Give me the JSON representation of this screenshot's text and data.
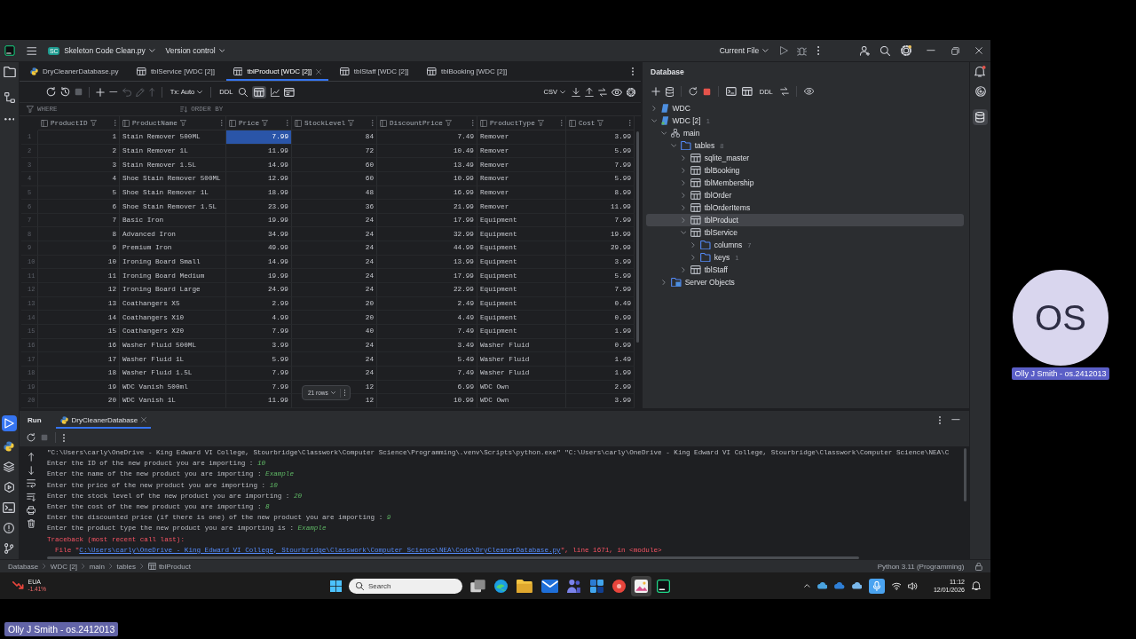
{
  "title_bar": {
    "project_badge": "SC",
    "project": "Skeleton Code Clean.py",
    "vcs": "Version control",
    "run_config": "Current File",
    "settings_badge": true
  },
  "left_tools": {
    "top": [
      {
        "kind": "project",
        "selected": false
      },
      {
        "kind": "structure",
        "selected": false
      },
      {
        "kind": "more",
        "selected": false
      }
    ],
    "bottom": [
      {
        "kind": "run",
        "selected": true
      },
      {
        "kind": "python",
        "selected": false
      },
      {
        "kind": "layers",
        "selected": false
      },
      {
        "kind": "services",
        "selected": false
      },
      {
        "kind": "terminal",
        "selected": false
      },
      {
        "kind": "problems",
        "selected": false
      },
      {
        "kind": "git",
        "selected": false
      }
    ]
  },
  "right_tools": [
    {
      "kind": "notifications",
      "selected": false,
      "badge": true
    },
    {
      "kind": "assistant",
      "selected": false,
      "badge": false
    },
    {
      "kind": "database",
      "selected": true,
      "badge": false
    }
  ],
  "editor_tabs": [
    {
      "label": "DryCleanerDatabase.py",
      "kind": "python",
      "selected": false
    },
    {
      "label": "tblService [WDC [2]]",
      "kind": "table",
      "selected": false
    },
    {
      "label": "tblProduct [WDC [2]]",
      "kind": "table",
      "selected": true
    },
    {
      "label": "tblStaff [WDC [2]]",
      "kind": "table",
      "selected": false
    },
    {
      "label": "tblBooking [WDC [2]]",
      "kind": "table",
      "selected": false
    }
  ],
  "grid_toolbar": {
    "tx_mode": "Tx: Auto",
    "ddl": "DDL",
    "format": "CSV",
    "table_view_selected": true
  },
  "filter_bar": {
    "where": "WHERE",
    "order_by": "ORDER BY"
  },
  "table": {
    "columns": [
      {
        "name": "ProductID",
        "kind": "number"
      },
      {
        "name": "ProductName",
        "kind": "text"
      },
      {
        "name": "Price",
        "kind": "number"
      },
      {
        "name": "StockLevel",
        "kind": "number"
      },
      {
        "name": "DiscountPrice",
        "kind": "number"
      },
      {
        "name": "ProductType",
        "kind": "text"
      },
      {
        "name": "Cost",
        "kind": "number"
      }
    ],
    "rows": [
      {
        "number": "1",
        "cells": [
          {
            "text": "1",
            "selected": false
          },
          {
            "text": "Stain Remover 500ML",
            "selected": false
          },
          {
            "text": "7.99",
            "selected": true
          },
          {
            "text": "84",
            "selected": false
          },
          {
            "text": "7.49",
            "selected": false
          },
          {
            "text": "Remover",
            "selected": false
          },
          {
            "text": "3.99",
            "selected": false
          }
        ]
      },
      {
        "number": "2",
        "cells": [
          {
            "text": "2",
            "selected": false
          },
          {
            "text": "Stain Remover 1L",
            "selected": false
          },
          {
            "text": "11.99",
            "selected": false
          },
          {
            "text": "72",
            "selected": false
          },
          {
            "text": "10.49",
            "selected": false
          },
          {
            "text": "Remover",
            "selected": false
          },
          {
            "text": "5.99",
            "selected": false
          }
        ]
      },
      {
        "number": "3",
        "cells": [
          {
            "text": "3",
            "selected": false
          },
          {
            "text": "Stain Remover 1.5L",
            "selected": false
          },
          {
            "text": "14.99",
            "selected": false
          },
          {
            "text": "60",
            "selected": false
          },
          {
            "text": "13.49",
            "selected": false
          },
          {
            "text": "Remover",
            "selected": false
          },
          {
            "text": "7.99",
            "selected": false
          }
        ]
      },
      {
        "number": "4",
        "cells": [
          {
            "text": "4",
            "selected": false
          },
          {
            "text": "Shoe Stain Remover 500ML",
            "selected": false
          },
          {
            "text": "12.99",
            "selected": false
          },
          {
            "text": "60",
            "selected": false
          },
          {
            "text": "10.99",
            "selected": false
          },
          {
            "text": "Remover",
            "selected": false
          },
          {
            "text": "5.99",
            "selected": false
          }
        ]
      },
      {
        "number": "5",
        "cells": [
          {
            "text": "5",
            "selected": false
          },
          {
            "text": "Shoe Stain Remover 1L",
            "selected": false
          },
          {
            "text": "18.99",
            "selected": false
          },
          {
            "text": "48",
            "selected": false
          },
          {
            "text": "16.99",
            "selected": false
          },
          {
            "text": "Remover",
            "selected": false
          },
          {
            "text": "8.99",
            "selected": false
          }
        ]
      },
      {
        "number": "6",
        "cells": [
          {
            "text": "6",
            "selected": false
          },
          {
            "text": "Shoe Stain Remover 1.5L",
            "selected": false
          },
          {
            "text": "23.99",
            "selected": false
          },
          {
            "text": "36",
            "selected": false
          },
          {
            "text": "21.99",
            "selected": false
          },
          {
            "text": "Remover",
            "selected": false
          },
          {
            "text": "11.99",
            "selected": false
          }
        ]
      },
      {
        "number": "7",
        "cells": [
          {
            "text": "7",
            "selected": false
          },
          {
            "text": "Basic Iron",
            "selected": false
          },
          {
            "text": "19.99",
            "selected": false
          },
          {
            "text": "24",
            "selected": false
          },
          {
            "text": "17.99",
            "selected": false
          },
          {
            "text": "Equipment",
            "selected": false
          },
          {
            "text": "7.99",
            "selected": false
          }
        ]
      },
      {
        "number": "8",
        "cells": [
          {
            "text": "8",
            "selected": false
          },
          {
            "text": "Advanced Iron",
            "selected": false
          },
          {
            "text": "34.99",
            "selected": false
          },
          {
            "text": "24",
            "selected": false
          },
          {
            "text": "32.99",
            "selected": false
          },
          {
            "text": "Equipment",
            "selected": false
          },
          {
            "text": "19.99",
            "selected": false
          }
        ]
      },
      {
        "number": "9",
        "cells": [
          {
            "text": "9",
            "selected": false
          },
          {
            "text": "Premium Iron",
            "selected": false
          },
          {
            "text": "49.99",
            "selected": false
          },
          {
            "text": "24",
            "selected": false
          },
          {
            "text": "44.99",
            "selected": false
          },
          {
            "text": "Equipment",
            "selected": false
          },
          {
            "text": "29.99",
            "selected": false
          }
        ]
      },
      {
        "number": "10",
        "cells": [
          {
            "text": "10",
            "selected": false
          },
          {
            "text": "Ironing Board Small",
            "selected": false
          },
          {
            "text": "14.99",
            "selected": false
          },
          {
            "text": "24",
            "selected": false
          },
          {
            "text": "13.99",
            "selected": false
          },
          {
            "text": "Equipment",
            "selected": false
          },
          {
            "text": "3.99",
            "selected": false
          }
        ]
      },
      {
        "number": "11",
        "cells": [
          {
            "text": "11",
            "selected": false
          },
          {
            "text": "Ironing Board Medium",
            "selected": false
          },
          {
            "text": "19.99",
            "selected": false
          },
          {
            "text": "24",
            "selected": false
          },
          {
            "text": "17.99",
            "selected": false
          },
          {
            "text": "Equipment",
            "selected": false
          },
          {
            "text": "5.99",
            "selected": false
          }
        ]
      },
      {
        "number": "12",
        "cells": [
          {
            "text": "12",
            "selected": false
          },
          {
            "text": "Ironing Board Large",
            "selected": false
          },
          {
            "text": "24.99",
            "selected": false
          },
          {
            "text": "24",
            "selected": false
          },
          {
            "text": "22.99",
            "selected": false
          },
          {
            "text": "Equipment",
            "selected": false
          },
          {
            "text": "7.99",
            "selected": false
          }
        ]
      },
      {
        "number": "13",
        "cells": [
          {
            "text": "13",
            "selected": false
          },
          {
            "text": "Coathangers X5",
            "selected": false
          },
          {
            "text": "2.99",
            "selected": false
          },
          {
            "text": "20",
            "selected": false
          },
          {
            "text": "2.49",
            "selected": false
          },
          {
            "text": "Equipment",
            "selected": false
          },
          {
            "text": "0.49",
            "selected": false
          }
        ]
      },
      {
        "number": "14",
        "cells": [
          {
            "text": "14",
            "selected": false
          },
          {
            "text": "Coathangers X10",
            "selected": false
          },
          {
            "text": "4.99",
            "selected": false
          },
          {
            "text": "20",
            "selected": false
          },
          {
            "text": "4.49",
            "selected": false
          },
          {
            "text": "Equipment",
            "selected": false
          },
          {
            "text": "0.99",
            "selected": false
          }
        ]
      },
      {
        "number": "15",
        "cells": [
          {
            "text": "15",
            "selected": false
          },
          {
            "text": "Coathangers X20",
            "selected": false
          },
          {
            "text": "7.99",
            "selected": false
          },
          {
            "text": "40",
            "selected": false
          },
          {
            "text": "7.49",
            "selected": false
          },
          {
            "text": "Equipment",
            "selected": false
          },
          {
            "text": "1.99",
            "selected": false
          }
        ]
      },
      {
        "number": "16",
        "cells": [
          {
            "text": "16",
            "selected": false
          },
          {
            "text": "Washer Fluid 500ML",
            "selected": false
          },
          {
            "text": "3.99",
            "selected": false
          },
          {
            "text": "24",
            "selected": false
          },
          {
            "text": "3.49",
            "selected": false
          },
          {
            "text": "Washer Fluid",
            "selected": false
          },
          {
            "text": "0.99",
            "selected": false
          }
        ]
      },
      {
        "number": "17",
        "cells": [
          {
            "text": "17",
            "selected": false
          },
          {
            "text": "Washer Fluid 1L",
            "selected": false
          },
          {
            "text": "5.99",
            "selected": false
          },
          {
            "text": "24",
            "selected": false
          },
          {
            "text": "5.49",
            "selected": false
          },
          {
            "text": "Washer Fluid",
            "selected": false
          },
          {
            "text": "1.49",
            "selected": false
          }
        ]
      },
      {
        "number": "18",
        "cells": [
          {
            "text": "18",
            "selected": false
          },
          {
            "text": "Washer Fluid 1.5L",
            "selected": false
          },
          {
            "text": "7.99",
            "selected": false
          },
          {
            "text": "24",
            "selected": false
          },
          {
            "text": "7.49",
            "selected": false
          },
          {
            "text": "Washer Fluid",
            "selected": false
          },
          {
            "text": "1.99",
            "selected": false
          }
        ]
      },
      {
        "number": "19",
        "cells": [
          {
            "text": "19",
            "selected": false
          },
          {
            "text": "WDC Vanish 500ml",
            "selected": false
          },
          {
            "text": "7.99",
            "selected": false
          },
          {
            "text": "12",
            "selected": false
          },
          {
            "text": "6.99",
            "selected": false
          },
          {
            "text": "WDC Own",
            "selected": false
          },
          {
            "text": "2.99",
            "selected": false
          }
        ]
      },
      {
        "number": "20",
        "cells": [
          {
            "text": "20",
            "selected": false
          },
          {
            "text": "WDC Vanish 1L",
            "selected": false
          },
          {
            "text": "11.99",
            "selected": false
          },
          {
            "text": "12",
            "selected": false
          },
          {
            "text": "10.99",
            "selected": false
          },
          {
            "text": "WDC Own",
            "selected": false
          },
          {
            "text": "3.99",
            "selected": false
          }
        ]
      }
    ],
    "row_count": "21 rows"
  },
  "database_panel": {
    "title": "Database",
    "ddl": "DDL",
    "tree": [
      {
        "label": "WDC",
        "kind": "datasource",
        "connected": false,
        "expanded": false,
        "selected": false
      },
      {
        "label": "WDC [2]",
        "kind": "datasource",
        "connected": true,
        "count": "1",
        "expanded": true,
        "selected": false,
        "children": [
          {
            "label": "main",
            "kind": "schema",
            "expanded": true,
            "selected": false,
            "children": [
              {
                "label": "tables",
                "kind": "folder",
                "count": "8",
                "expanded": true,
                "selected": false,
                "children": [
                  {
                    "label": "sqlite_master",
                    "kind": "table",
                    "expanded": false,
                    "selected": false
                  },
                  {
                    "label": "tblBooking",
                    "kind": "table",
                    "expanded": false,
                    "selected": false
                  },
                  {
                    "label": "tblMembership",
                    "kind": "table",
                    "expanded": false,
                    "selected": false
                  },
                  {
                    "label": "tblOrder",
                    "kind": "table",
                    "expanded": false,
                    "selected": false
                  },
                  {
                    "label": "tblOrderItems",
                    "kind": "table",
                    "expanded": false,
                    "selected": false
                  },
                  {
                    "label": "tblProduct",
                    "kind": "table",
                    "expanded": false,
                    "selected": true
                  },
                  {
                    "label": "tblService",
                    "kind": "table",
                    "expanded": true,
                    "selected": false,
                    "children": [
                      {
                        "label": "columns",
                        "kind": "folder",
                        "count": "7",
                        "expanded": false,
                        "selected": false
                      },
                      {
                        "label": "keys",
                        "kind": "folder",
                        "count": "1",
                        "expanded": false,
                        "selected": false
                      }
                    ]
                  },
                  {
                    "label": "tblStaff",
                    "kind": "table",
                    "expanded": false,
                    "selected": false
                  }
                ]
              }
            ]
          },
          {
            "label": "Server Objects",
            "kind": "server",
            "expanded": false,
            "selected": false
          }
        ]
      }
    ]
  },
  "run_panel": {
    "title": "Run",
    "tabs": [
      {
        "label": "DryCleanerDatabase",
        "selected": true
      }
    ],
    "console": [
      {
        "kind": "command",
        "text": "\"C:\\Users\\carly\\OneDrive - King Edward VI College, Stourbridge\\Classwork\\Computer Science\\Programming\\.venv\\Scripts\\python.exe\" \"C:\\Users\\carly\\OneDrive - King Edward VI College, Stourbridge\\Classwork\\Computer Science\\NEA\\C"
      },
      {
        "kind": "prompt",
        "text": "Enter the ID of the new product you are importing :",
        "input": "10"
      },
      {
        "kind": "prompt",
        "text": "Enter the name of the new product you are importing :",
        "input": "Example"
      },
      {
        "kind": "prompt",
        "text": "Enter the price of the new product you are importing :",
        "input": "10"
      },
      {
        "kind": "prompt",
        "text": "Enter the stock level of the new product you are importing :",
        "input": "20"
      },
      {
        "kind": "prompt",
        "text": "Enter the cost of the new product you are importing :",
        "input": "8"
      },
      {
        "kind": "prompt",
        "text": "Enter the discounted price (if there is one) of the new product you are importing :",
        "input": "9"
      },
      {
        "kind": "prompt",
        "text": "Enter the product type the new product you are importing is :",
        "input": "Example"
      },
      {
        "kind": "error",
        "text": "Traceback (most recent call last):"
      },
      {
        "kind": "frame",
        "prefix": "File \"",
        "link": "C:\\Users\\carly\\OneDrive - King Edward VI College, Stourbridge\\Classwork\\Computer Science\\NEA\\Code\\DryCleanerDatabase.py",
        "suffix": "\", line 1671, in <module>"
      }
    ]
  },
  "status_bar": {
    "breadcrumbs": [
      {
        "label": "Database",
        "kind": "plain"
      },
      {
        "label": "WDC [2]",
        "kind": "plain"
      },
      {
        "label": "main",
        "kind": "plain"
      },
      {
        "label": "tables",
        "kind": "plain"
      },
      {
        "label": "tblProduct",
        "kind": "table"
      }
    ],
    "interpreter": "Python 3.11 (Programming)"
  },
  "taskbar": {
    "widget": {
      "label": "EUA",
      "change": "-1.41%"
    },
    "search": {
      "placeholder": "Search"
    },
    "apps": [
      {
        "kind": "task-view",
        "selected": false
      },
      {
        "kind": "swirl",
        "selected": false
      },
      {
        "kind": "folder",
        "selected": false
      },
      {
        "kind": "mail",
        "selected": false
      },
      {
        "kind": "people",
        "selected": false
      },
      {
        "kind": "tiles",
        "selected": false
      },
      {
        "kind": "disc",
        "selected": false
      },
      {
        "kind": "picture",
        "selected": true
      },
      {
        "kind": "code",
        "selected": false
      }
    ],
    "mic_active": true,
    "time": "11:12",
    "date": "12/01/2026"
  },
  "participant": {
    "initials": "OS",
    "name": "Olly J Smith - os.2412013"
  },
  "presenter_label": "Olly J Smith - os.2412013"
}
